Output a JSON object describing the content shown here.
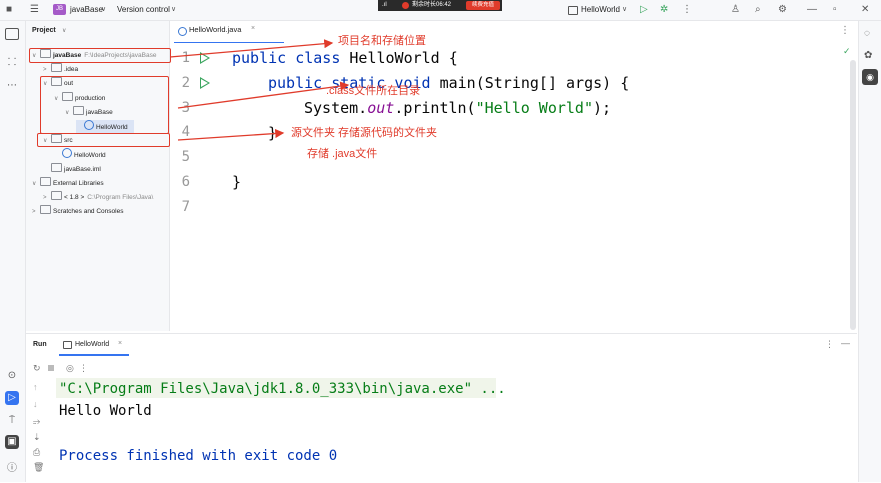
{
  "titlebar": {
    "project_badge": "JB",
    "project_name": "javaBase",
    "vcs_label": "Version control",
    "timer_text": "剩余时长06:42",
    "timer_button": "续费充值",
    "run_config": "HelloWorld"
  },
  "project_panel": {
    "title": "Project",
    "tree": [
      {
        "label": "javaBase",
        "path": "F:\\IdeaProjects\\javaBase",
        "arrow": "∨",
        "indent": 0,
        "icon": "folder"
      },
      {
        "label": ".idea",
        "path": "",
        "arrow": ">",
        "indent": 1,
        "icon": "folder"
      },
      {
        "label": "out",
        "path": "",
        "arrow": "∨",
        "indent": 1,
        "icon": "folder"
      },
      {
        "label": "production",
        "path": "",
        "arrow": "∨",
        "indent": 2,
        "icon": "folder"
      },
      {
        "label": "javaBase",
        "path": "",
        "arrow": "∨",
        "indent": 3,
        "icon": "folder"
      },
      {
        "label": "HelloWorld",
        "path": "",
        "arrow": "",
        "indent": 4,
        "icon": "class"
      },
      {
        "label": "src",
        "path": "",
        "arrow": "∨",
        "indent": 1,
        "icon": "folder"
      },
      {
        "label": "HelloWorld",
        "path": "",
        "arrow": "",
        "indent": 2,
        "icon": "class"
      },
      {
        "label": "javaBase.iml",
        "path": "",
        "arrow": "",
        "indent": 1,
        "icon": "file"
      },
      {
        "label": "External Libraries",
        "path": "",
        "arrow": "∨",
        "indent": 0,
        "icon": "lib"
      },
      {
        "label": "< 1.8 >",
        "path": "C:\\Program Files\\Java\\",
        "arrow": ">",
        "indent": 1,
        "icon": "folder"
      },
      {
        "label": "Scratches and Consoles",
        "path": "",
        "arrow": ">",
        "indent": 0,
        "icon": "scratch"
      }
    ]
  },
  "editor": {
    "tab_label": "HelloWorld.java",
    "line_numbers": [
      "1",
      "2",
      "3",
      "4",
      "5",
      "6",
      "7"
    ],
    "code": {
      "l1_kw": "public class ",
      "l1_rest": "HelloWorld {",
      "l2_kw": "public static void ",
      "l2_rest": "main(String[] args) {",
      "l3_a": "System.",
      "l3_it": "out",
      "l3_b": ".println(",
      "l3_str": "\"Hello World\"",
      "l3_c": ");",
      "l4": "}",
      "l6": "}"
    }
  },
  "annotations": {
    "project": "项目名和存储位置",
    "class_dir": ".class文件所在目录",
    "src_dir": "源文件夹  存储源代码的文件夹",
    "src_store": "存储 .java文件"
  },
  "run_panel": {
    "title": "Run",
    "tab_label": "HelloWorld",
    "lines": [
      "\"C:\\Program Files\\Java\\jdk1.8.0_333\\bin\\java.exe\" ...",
      "Hello World",
      "",
      "Process finished with exit code 0"
    ]
  },
  "colors": {
    "annotation": "#e03b2b",
    "keyword": "#0033b3",
    "string": "#067d17",
    "run_green": "#3aa55e"
  }
}
